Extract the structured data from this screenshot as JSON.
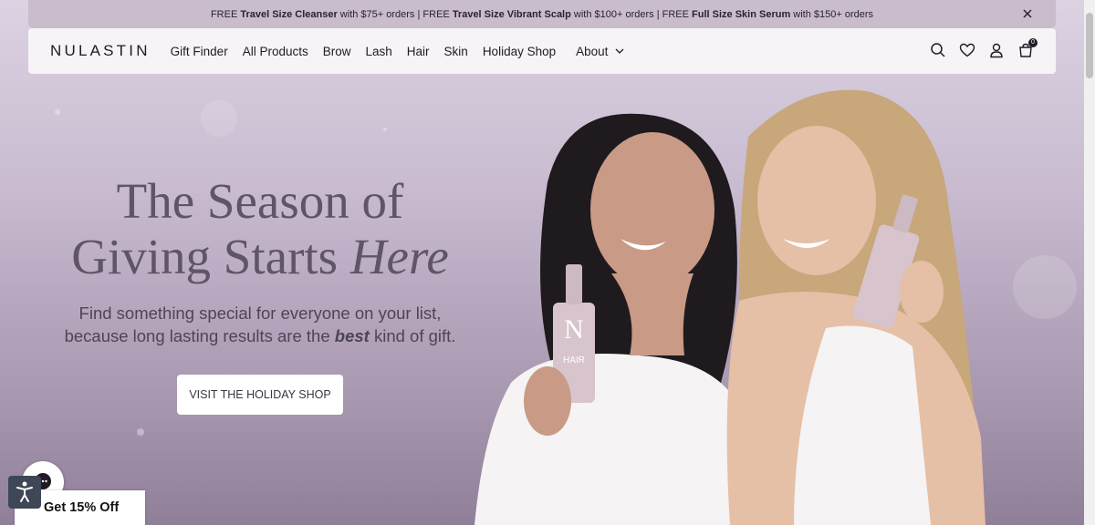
{
  "announcement": {
    "segments": [
      {
        "pre": "FREE ",
        "bold": "Travel Size Cleanser",
        "post": " with $75+ orders | "
      },
      {
        "pre": "FREE ",
        "bold": "Travel Size Vibrant Scalp",
        "post": " with $100+ orders | "
      },
      {
        "pre": "FREE ",
        "bold": "Full Size Skin Serum",
        "post": " with $150+ orders"
      }
    ],
    "close_icon": "close-icon"
  },
  "nav": {
    "logo": "NULASTIN",
    "items": [
      "Gift Finder",
      "All Products",
      "Brow",
      "Lash",
      "Hair",
      "Skin",
      "Holiday Shop"
    ],
    "about": "About",
    "icons": [
      "search-icon",
      "heart-icon",
      "account-icon",
      "cart-icon"
    ],
    "cart_count": "0"
  },
  "hero": {
    "headline_line1": "The Season of",
    "headline_line2_plain": "Giving Starts ",
    "headline_line2_italic": "Here",
    "sub_line1": "Find something special for everyone on your list,",
    "sub_line2_pre": "because long lasting results are the ",
    "sub_line2_bold": "best",
    "sub_line2_post": " kind of gift.",
    "cta": "VISIT THE HOLIDAY SHOP",
    "bottle_label_letter": "N",
    "bottle_label_word": "HAIR"
  },
  "widgets": {
    "discount": "Get 15% Off",
    "accessibility_icon": "accessibility-icon",
    "chat_icon": "chat-icon"
  }
}
